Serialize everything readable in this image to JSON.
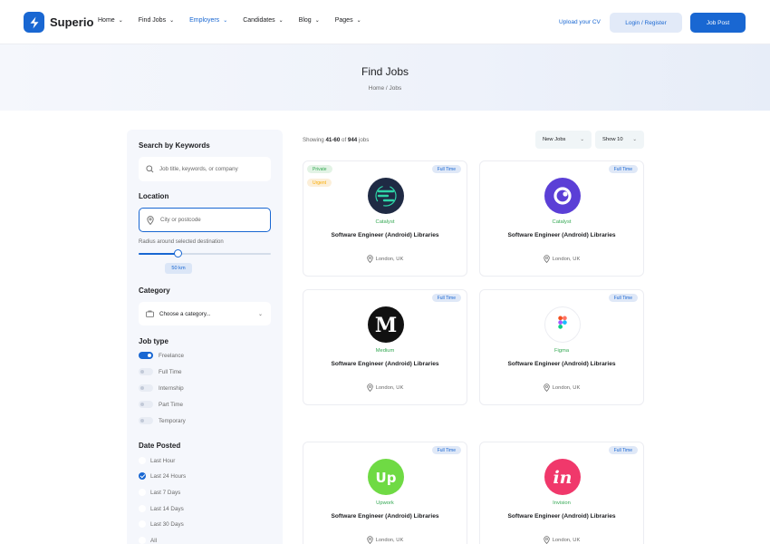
{
  "header": {
    "brand": "Superio",
    "nav": [
      {
        "label": "Home",
        "active": false
      },
      {
        "label": "Find Jobs",
        "active": false
      },
      {
        "label": "Employers",
        "active": true
      },
      {
        "label": "Candidates",
        "active": false
      },
      {
        "label": "Blog",
        "active": false
      },
      {
        "label": "Pages",
        "active": false
      }
    ],
    "upload_cv": "Upload your CV",
    "login": "Login / Register",
    "job_post": "Job Post"
  },
  "banner": {
    "title": "Find Jobs",
    "breadcrumb": "Home / Jobs"
  },
  "sidebar": {
    "search_heading": "Search by Keywords",
    "search_placeholder": "Job title, keywords, or company",
    "location_heading": "Location",
    "location_placeholder": "City or postcode",
    "radius_label": "Radius around selected destination",
    "radius_value": "50 km",
    "radius_fraction": 0.3,
    "category_heading": "Category",
    "category_placeholder": "Choose a category...",
    "job_type_heading": "Job type",
    "job_types": [
      {
        "label": "Freelance",
        "on": true
      },
      {
        "label": "Full Time",
        "on": false
      },
      {
        "label": "Internship",
        "on": false
      },
      {
        "label": "Part Time",
        "on": false
      },
      {
        "label": "Temporary",
        "on": false
      }
    ],
    "date_heading": "Date Posted",
    "date_options": [
      {
        "label": "Last Hour",
        "checked": false
      },
      {
        "label": "Last 24 Hours",
        "checked": true
      },
      {
        "label": "Last 7 Days",
        "checked": false
      },
      {
        "label": "Last 14 Days",
        "checked": false
      },
      {
        "label": "Last 30 Days",
        "checked": false
      },
      {
        "label": "All",
        "checked": false
      }
    ]
  },
  "results": {
    "showing_prefix": "Showing ",
    "showing_range": "41-60",
    "showing_mid": " of ",
    "showing_total": "944",
    "showing_suffix": " jobs",
    "sort": "New Jobs",
    "per_page": "Show 10"
  },
  "colors": {
    "accent": "#1967d2",
    "company": "#34a853"
  },
  "jobs": [
    {
      "company": "Catalyst",
      "title": "Software Engineer (Android) Libraries",
      "location": "London, UK",
      "type": "Full Time",
      "private": "Private",
      "urgent": "Urgent",
      "logo": "catalyst-dark-logo"
    },
    {
      "company": "Catalyst",
      "title": "Software Engineer (Android) Libraries",
      "location": "London, UK",
      "type": "Full Time",
      "logo": "catalyst-purple-logo"
    },
    {
      "company": "Medium",
      "title": "Software Engineer (Android) Libraries",
      "location": "London, UK",
      "type": "Full Time",
      "logo": "medium-logo"
    },
    {
      "company": "Figma",
      "title": "Software Engineer (Android) Libraries",
      "location": "London, UK",
      "type": "Full Time",
      "logo": "figma-logo"
    },
    {
      "company": "Upwork",
      "title": "Software Engineer (Android) Libraries",
      "location": "London, UK",
      "type": "Full Time",
      "logo": "upwork-logo"
    },
    {
      "company": "Invision",
      "title": "Software Engineer (Android) Libraries",
      "location": "London, UK",
      "type": "Full Time",
      "logo": "invision-logo"
    }
  ]
}
